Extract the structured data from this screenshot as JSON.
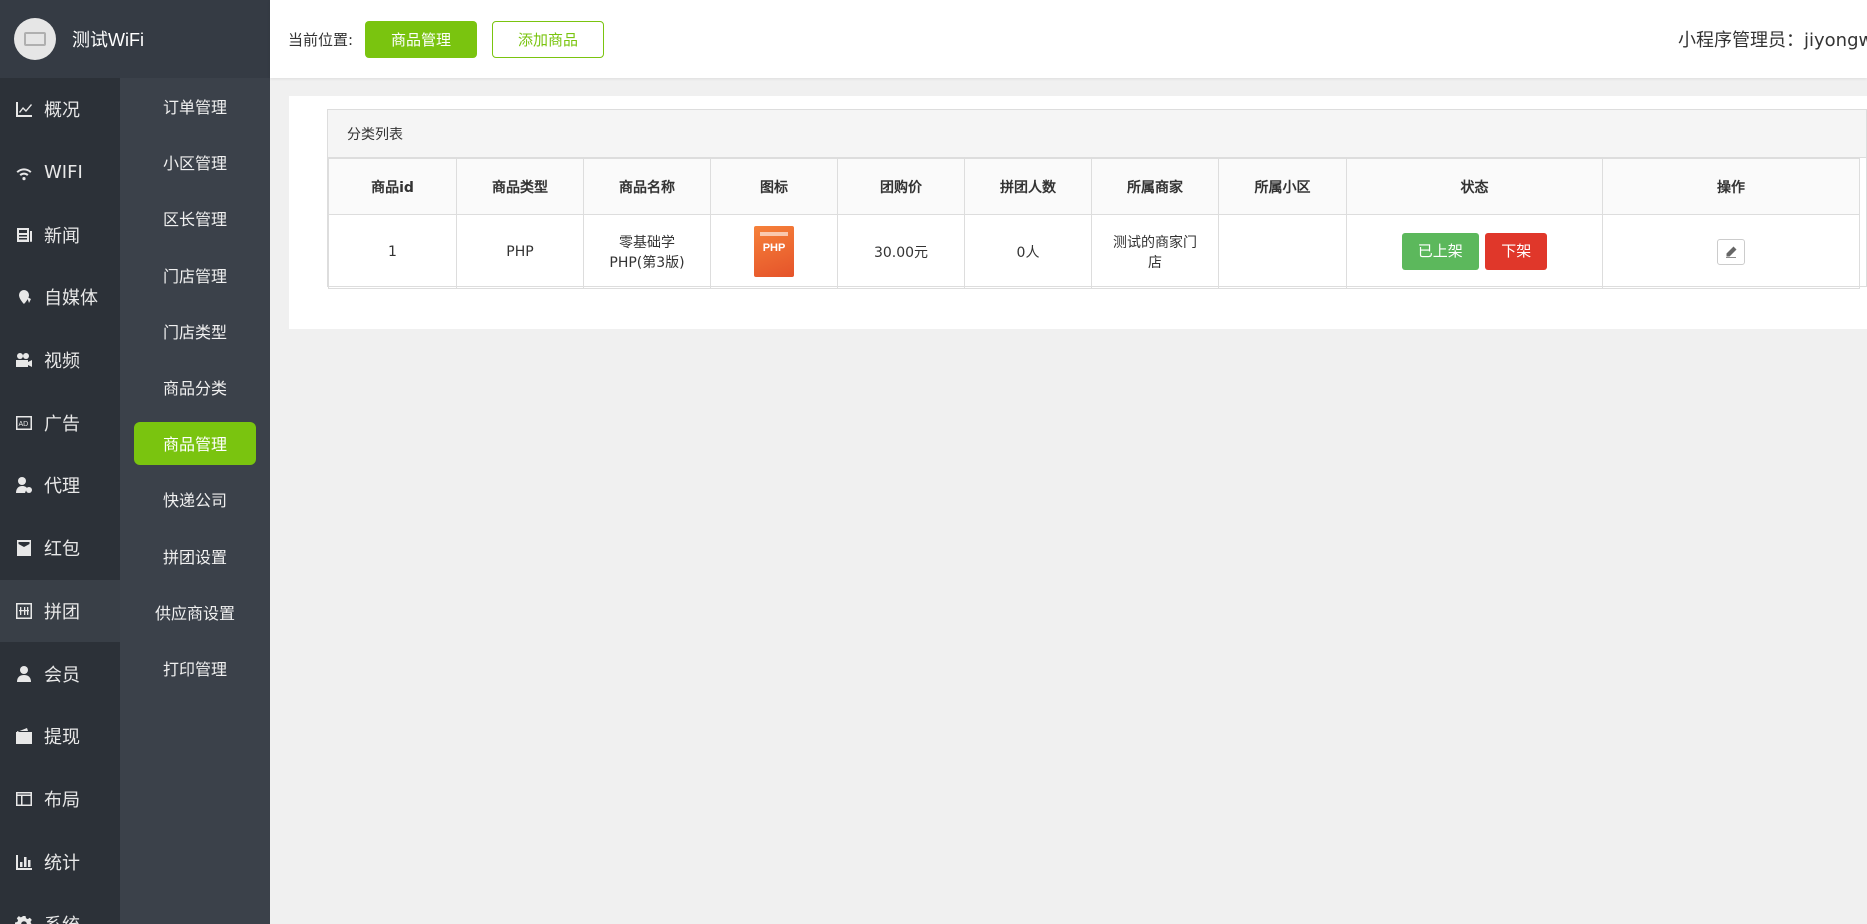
{
  "brand": {
    "title": "测试WiFi"
  },
  "nav_main": [
    {
      "label": "概况",
      "icon": "chart-line-icon"
    },
    {
      "label": "WIFI",
      "icon": "wifi-icon"
    },
    {
      "label": "新闻",
      "icon": "newspaper-icon"
    },
    {
      "label": "自媒体",
      "icon": "media-icon"
    },
    {
      "label": "视频",
      "icon": "video-icon"
    },
    {
      "label": "广告",
      "icon": "ad-icon"
    },
    {
      "label": "代理",
      "icon": "agent-icon"
    },
    {
      "label": "红包",
      "icon": "red-envelope-icon"
    },
    {
      "label": "拼团",
      "icon": "group-buy-icon",
      "active": true
    },
    {
      "label": "会员",
      "icon": "user-icon"
    },
    {
      "label": "提现",
      "icon": "wallet-icon"
    },
    {
      "label": "布局",
      "icon": "layout-icon"
    },
    {
      "label": "统计",
      "icon": "bar-chart-icon"
    },
    {
      "label": "系统",
      "icon": "gear-icon"
    }
  ],
  "nav_sub": [
    {
      "label": "订单管理"
    },
    {
      "label": "小区管理"
    },
    {
      "label": "区长管理"
    },
    {
      "label": "门店管理"
    },
    {
      "label": "门店类型"
    },
    {
      "label": "商品分类"
    },
    {
      "label": "商品管理",
      "active": true
    },
    {
      "label": "快递公司"
    },
    {
      "label": "拼团设置"
    },
    {
      "label": "供应商设置"
    },
    {
      "label": "打印管理"
    }
  ],
  "header": {
    "crumb_label": "当前位置:",
    "current_button": "商品管理",
    "add_button": "添加商品",
    "admin_text": "小程序管理员：jiyongwei"
  },
  "table": {
    "caption": "分类列表",
    "columns": [
      "商品id",
      "商品类型",
      "商品名称",
      "图标",
      "团购价",
      "拼团人数",
      "所属商家",
      "所属小区",
      "状态",
      "操作"
    ],
    "rows": [
      {
        "id": "1",
        "type": "PHP",
        "name_line1": "零基础学",
        "name_line2": "PHP(第3版)",
        "cover_text": "PHP",
        "price": "30.00元",
        "group_size": "0人",
        "merchant_line1": "测试的商家门",
        "merchant_line2": "店",
        "community": "",
        "status_on": "已上架",
        "status_off": "下架"
      }
    ]
  },
  "colors": {
    "accent": "#7ac40f",
    "sidebar_dark": "#2c3138",
    "sidebar_sub": "#3b414a",
    "on_green": "#5cb85c",
    "off_red": "#e0372a"
  }
}
